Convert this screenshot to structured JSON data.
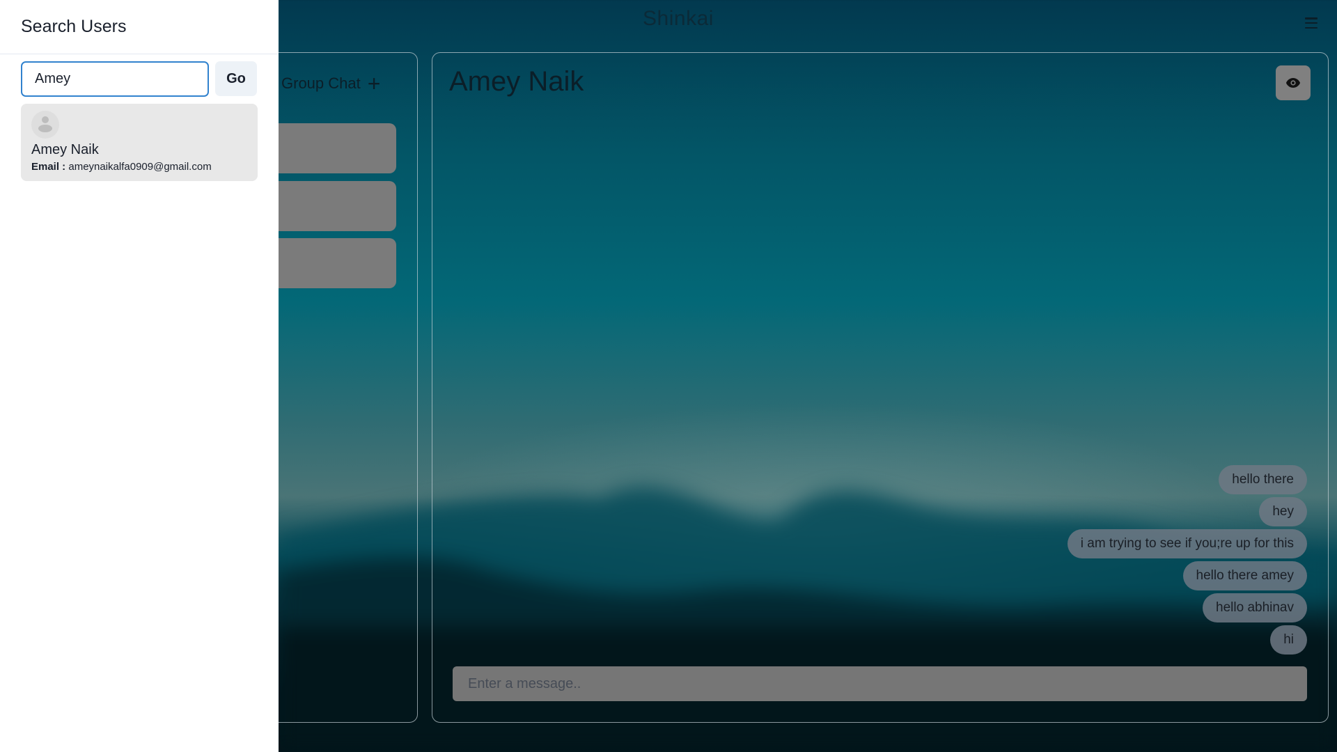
{
  "app": {
    "title": "Shinkai"
  },
  "header": {
    "menu_icon": "hamburger-menu-icon"
  },
  "chats_panel": {
    "group_chat_label": "Group Chat",
    "group_chat_icon": "plus-icon",
    "items_count": 3
  },
  "chat": {
    "title": "Amey Naik",
    "view_profile_icon": "eye-icon",
    "messages": [
      "hello there",
      "hey",
      "i am trying to see if you;re up for this",
      "hello there amey",
      "hello abhinav",
      "hi"
    ],
    "input_placeholder": "Enter a message..",
    "input_value": ""
  },
  "drawer": {
    "title": "Search Users",
    "search_value": "Amey",
    "go_label": "Go",
    "results": [
      {
        "name": "Amey Naik",
        "email_label": "Email :",
        "email": "ameynaikalfa0909@gmail.com",
        "avatar_icon": "default-user-avatar-icon"
      }
    ]
  },
  "colors": {
    "accent_focus": "#3182ce",
    "bubble": "#6e7884",
    "drawer_bg": "#ffffff",
    "result_bg": "#e8e8e8"
  }
}
